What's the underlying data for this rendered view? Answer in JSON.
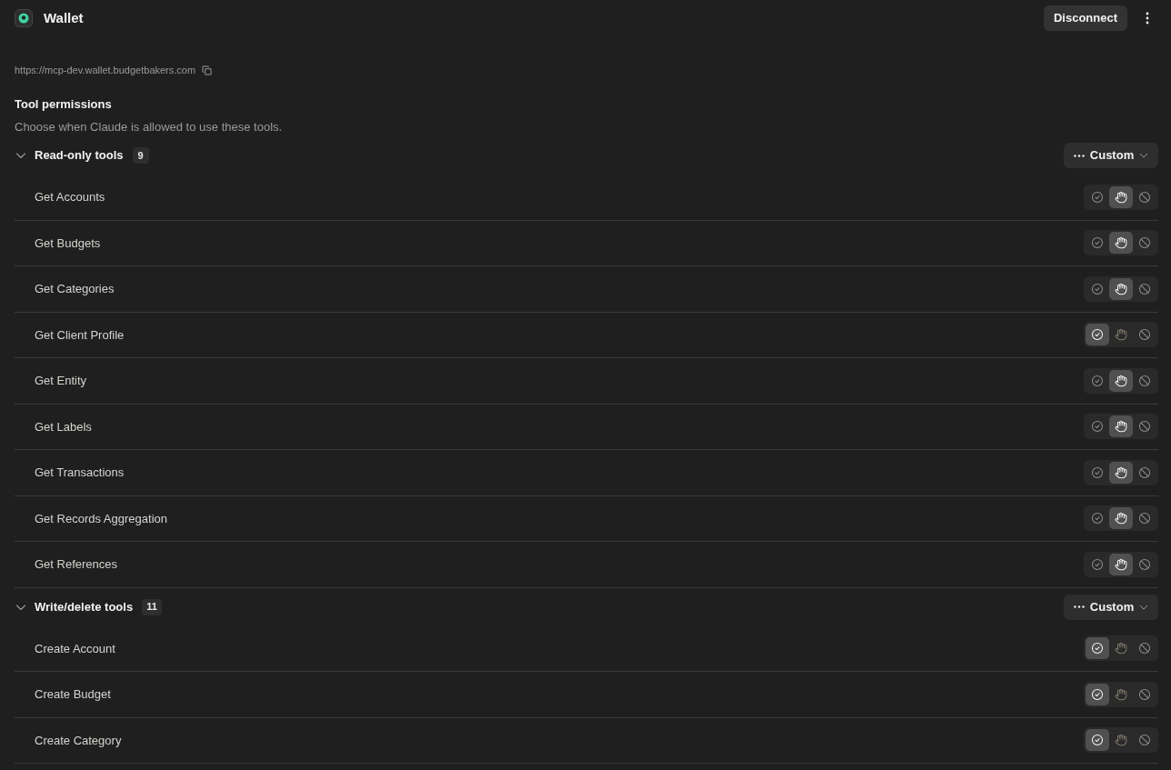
{
  "header": {
    "title": "Wallet",
    "disconnect_button": "Disconnect"
  },
  "server_url": "https://mcp-dev.wallet.budgetbakers.com",
  "permissions": {
    "title": "Tool permissions",
    "description": "Choose when Claude is allowed to use these tools."
  },
  "groups": [
    {
      "name": "Read-only tools",
      "count": "9",
      "expanded": true,
      "mode": "Custom",
      "tools": [
        {
          "name": "Get Accounts",
          "options": [
            {
              "kind": "allow",
              "selected": false
            },
            {
              "kind": "ask",
              "selected": true
            },
            {
              "kind": "block",
              "selected": false
            }
          ]
        },
        {
          "name": "Get Budgets",
          "options": [
            {
              "kind": "allow",
              "selected": false
            },
            {
              "kind": "ask",
              "selected": true
            },
            {
              "kind": "block",
              "selected": false
            }
          ]
        },
        {
          "name": "Get Categories",
          "options": [
            {
              "kind": "allow",
              "selected": false
            },
            {
              "kind": "ask",
              "selected": true
            },
            {
              "kind": "block",
              "selected": false
            }
          ]
        },
        {
          "name": "Get Client Profile",
          "options": [
            {
              "kind": "allow",
              "selected": true
            },
            {
              "kind": "ask",
              "selected": false
            },
            {
              "kind": "block",
              "selected": false
            }
          ]
        },
        {
          "name": "Get Entity",
          "options": [
            {
              "kind": "allow",
              "selected": false
            },
            {
              "kind": "ask",
              "selected": true
            },
            {
              "kind": "block",
              "selected": false
            }
          ]
        },
        {
          "name": "Get Labels",
          "options": [
            {
              "kind": "allow",
              "selected": false
            },
            {
              "kind": "ask",
              "selected": true
            },
            {
              "kind": "block",
              "selected": false
            }
          ]
        },
        {
          "name": "Get Transactions",
          "options": [
            {
              "kind": "allow",
              "selected": false
            },
            {
              "kind": "ask",
              "selected": true
            },
            {
              "kind": "block",
              "selected": false
            }
          ]
        },
        {
          "name": "Get Records Aggregation",
          "options": [
            {
              "kind": "allow",
              "selected": false
            },
            {
              "kind": "ask",
              "selected": true
            },
            {
              "kind": "block",
              "selected": false
            }
          ]
        },
        {
          "name": "Get References",
          "options": [
            {
              "kind": "allow",
              "selected": false
            },
            {
              "kind": "ask",
              "selected": true
            },
            {
              "kind": "block",
              "selected": false
            }
          ]
        }
      ]
    },
    {
      "name": "Write/delete tools",
      "count": "11",
      "expanded": true,
      "mode": "Custom",
      "tools": [
        {
          "name": "Create Account",
          "options": [
            {
              "kind": "allow",
              "selected": true
            },
            {
              "kind": "ask",
              "selected": false
            },
            {
              "kind": "block",
              "selected": false
            }
          ]
        },
        {
          "name": "Create Budget",
          "options": [
            {
              "kind": "allow",
              "selected": true
            },
            {
              "kind": "ask",
              "selected": false
            },
            {
              "kind": "block",
              "selected": false
            }
          ]
        },
        {
          "name": "Create Category",
          "options": [
            {
              "kind": "allow",
              "selected": true
            },
            {
              "kind": "ask",
              "selected": false
            },
            {
              "kind": "block",
              "selected": false
            }
          ]
        }
      ]
    }
  ]
}
